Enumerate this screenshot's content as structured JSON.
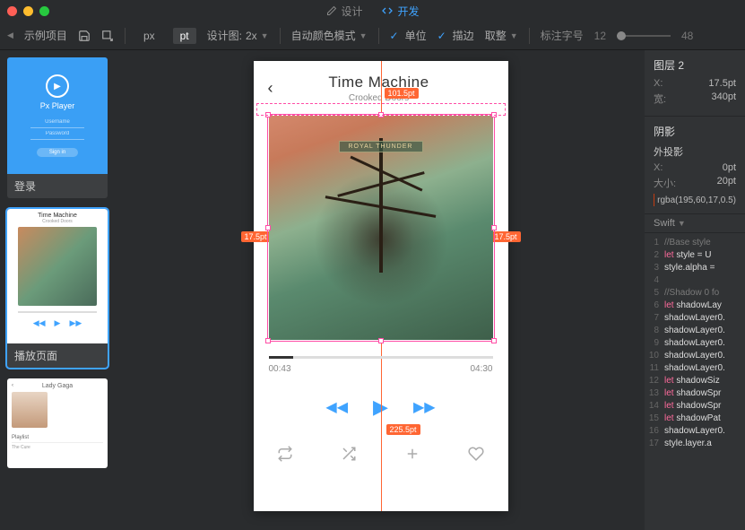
{
  "titlebar": {
    "tabs": {
      "design": "设计",
      "develop": "开发"
    }
  },
  "toolbar": {
    "project": "示例项目",
    "units": {
      "px": "px",
      "pt": "pt"
    },
    "artboard_label": "设计图:",
    "artboard_scale": "2x",
    "color_mode": "自动颜色模式",
    "unit_check": "单位",
    "stroke_check": "描边",
    "round": "取整",
    "font_label": "标注字号",
    "font_min": "12",
    "font_max": "48"
  },
  "sidebar": {
    "thumbs": [
      {
        "label": "登录",
        "app": "Px Player",
        "user": "Username",
        "pass": "Password",
        "signin": "Sign in"
      },
      {
        "label": "播放页面",
        "title": "Time Machine",
        "sub": "Crooked Doors"
      },
      {
        "label": "",
        "artist": "Lady Gaga",
        "playlist": "Playlist",
        "track": "The Cure"
      }
    ]
  },
  "artboard": {
    "title": "Time Machine",
    "subtitle": "Crooked Doors",
    "banner": "ROYAL THUNDER",
    "time_cur": "00:43",
    "time_end": "04:30"
  },
  "measurements": {
    "top": "101.5pt",
    "left": "17.5pt",
    "right": "17.5pt",
    "center": "225.5pt"
  },
  "inspector": {
    "layer_title": "图层 2",
    "x_label": "X:",
    "x_val": "17.5pt",
    "w_label": "宽:",
    "w_val": "340pt",
    "shadow_title": "阴影",
    "outer": "外投影",
    "sx_label": "X:",
    "sx_val": "0pt",
    "size_label": "大小:",
    "size_val": "20pt",
    "color": "rgba(195,60,17,0.5)",
    "lang": "Swift",
    "code": [
      {
        "n": "1",
        "t": "//Base style",
        "cls": "cm"
      },
      {
        "n": "2",
        "t": "let style = U",
        "cls": ""
      },
      {
        "n": "3",
        "t": "style.alpha =",
        "cls": ""
      },
      {
        "n": "4",
        "t": "",
        "cls": ""
      },
      {
        "n": "5",
        "t": "//Shadow 0 fo",
        "cls": "cm"
      },
      {
        "n": "6",
        "t": "let shadowLay",
        "cls": ""
      },
      {
        "n": "7",
        "t": "shadowLayer0.",
        "cls": ""
      },
      {
        "n": "8",
        "t": "shadowLayer0.",
        "cls": ""
      },
      {
        "n": "9",
        "t": "shadowLayer0.",
        "cls": ""
      },
      {
        "n": "10",
        "t": "shadowLayer0.",
        "cls": ""
      },
      {
        "n": "11",
        "t": "shadowLayer0.",
        "cls": ""
      },
      {
        "n": "12",
        "t": "let shadowSiz",
        "cls": ""
      },
      {
        "n": "13",
        "t": "let shadowSpr",
        "cls": ""
      },
      {
        "n": "14",
        "t": "let shadowSpr",
        "cls": ""
      },
      {
        "n": "15",
        "t": "let shadowPat",
        "cls": ""
      },
      {
        "n": "16",
        "t": "shadowLayer0.",
        "cls": ""
      },
      {
        "n": "17",
        "t": "style.layer.a",
        "cls": ""
      }
    ]
  }
}
